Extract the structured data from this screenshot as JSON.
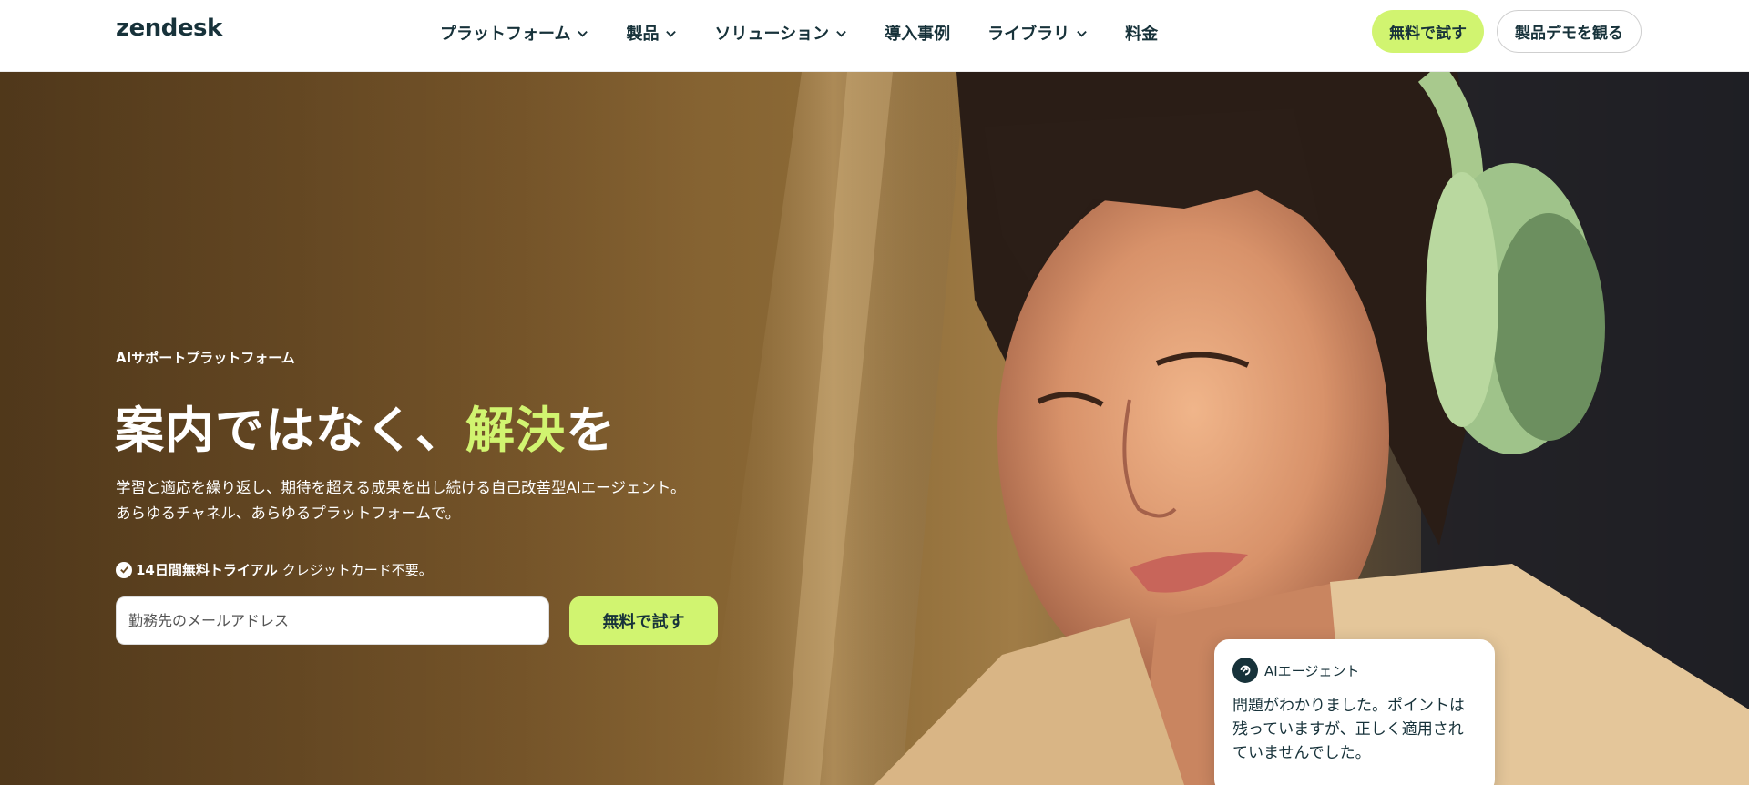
{
  "header": {
    "logo": "zendesk",
    "nav": [
      {
        "label": "プラットフォーム",
        "has_dropdown": true
      },
      {
        "label": "製品",
        "has_dropdown": true
      },
      {
        "label": "ソリューション",
        "has_dropdown": true
      },
      {
        "label": "導入事例",
        "has_dropdown": false
      },
      {
        "label": "ライブラリ",
        "has_dropdown": true
      },
      {
        "label": "料金",
        "has_dropdown": false
      }
    ],
    "trial_button": "無料で試す",
    "demo_button": "製品デモを観る"
  },
  "hero": {
    "eyebrow": "AIサポートプラットフォーム",
    "headline_part1": "案内ではなく、",
    "headline_accent": "解決",
    "headline_part2": "を",
    "description_line1": "学習と適応を繰り返し、期待を超える成果を出し続ける自己改善型AIエージェント。",
    "description_line2": "あらゆるチャネル、あらゆるプラットフォームで。",
    "trial_note_bold": "14日間無料トライアル",
    "trial_note_rest": "クレジットカード不要。",
    "email_placeholder": "勤務先のメールアドレス",
    "cta_button": "無料で試す"
  },
  "chat_card": {
    "agent_name": "AIエージェント",
    "message": "問題がわかりました。ポイントは残っていますが、正しく適用されていませんでした。"
  },
  "colors": {
    "accent": "#d1f470",
    "brand_dark": "#17323a"
  },
  "icons": [
    "chevron-down-icon",
    "checkmark-circle-icon",
    "ai-agent-icon"
  ]
}
